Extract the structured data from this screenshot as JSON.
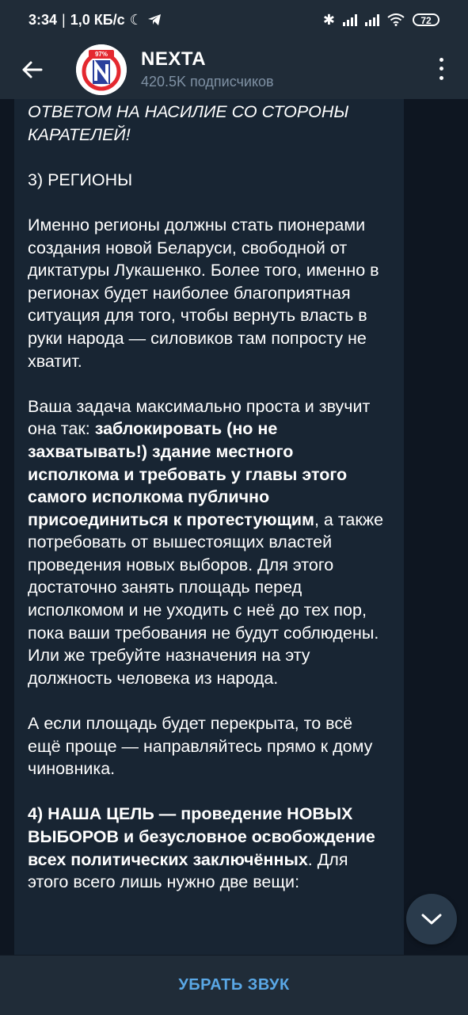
{
  "statusbar": {
    "time": "3:34",
    "net_speed": "1,0 КБ/с",
    "battery": "72"
  },
  "header": {
    "title": "NEXTA",
    "subtitle": "420.5K подписчиков",
    "avatar_badge": "97%",
    "avatar_letter": "N"
  },
  "message": {
    "p1_italic": "ОТВЕТОМ НА НАСИЛИЕ СО СТОРОНЫ КАРАТЕЛЕЙ!",
    "p2_heading": "3) РЕГИОНЫ",
    "p3": "Именно регионы должны стать пионерами создания новой Беларуси, свободной от диктатуры Лукашенко. Более того, именно в регионах будет наиболее благоприятная ситуация для того, чтобы вернуть власть в руки народа — силовиков там попросту не хватит.",
    "p4_a": "Ваша задача максимально проста и звучит она так: ",
    "p4_bold": "заблокировать (но не захватывать!) здание местного исполкома и требовать у главы этого самого исполкома публично присоединиться к протестующим",
    "p4_b": ", а также потребовать от вышестоящих властей проведения новых выборов. Для этого достаточно занять площадь перед исполкомом и не уходить с неё до тех пор, пока ваши требования не будут соблюдены. Или же требуйте назначения на эту должность человека из народа.",
    "p5": "А если площадь будет перекрыта, то всё ещё проще — направляйтесь прямо к дому чиновника.",
    "p6_bold": "4) НАША ЦЕЛЬ — проведение НОВЫХ ВЫБОРОВ и безусловное освобождение всех политических заключённых",
    "p6_rest": ". Для этого всего лишь нужно две вещи:"
  },
  "bottom": {
    "mute_label": "УБРАТЬ ЗВУК"
  },
  "icons": {
    "back": "arrow-left-icon",
    "menu": "more-vertical-icon",
    "scroll_down": "chevron-down-icon"
  },
  "colors": {
    "bg": "#0e1621",
    "bar": "#202c38",
    "bubble": "#182533",
    "accent": "#5aa8e6",
    "avatar_red": "#e4282f",
    "avatar_blue": "#2a3f9c"
  }
}
